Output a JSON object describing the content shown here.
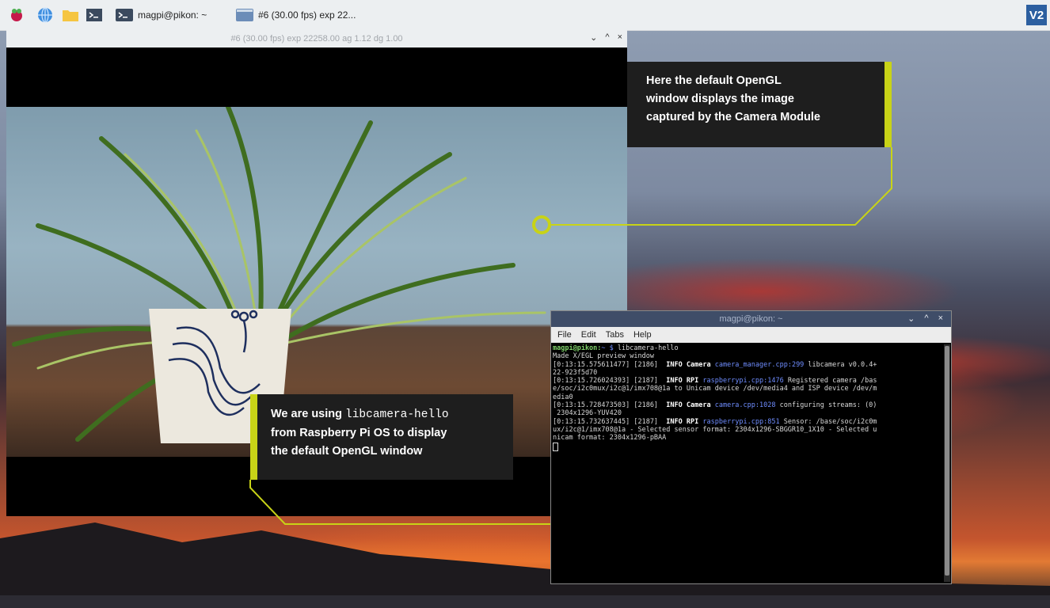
{
  "taskbar": {
    "tasks": [
      {
        "label": "magpi@pikon: ~",
        "icon": "terminal-icon"
      },
      {
        "label": "#6 (30.00 fps) exp 22...",
        "icon": "preview-window-icon"
      }
    ],
    "vnc_label": "V2"
  },
  "preview_window": {
    "title": "#6 (30.00 fps) exp 22258.00 ag 1.12 dg 1.00",
    "controls": [
      "⌄",
      "^",
      "×"
    ]
  },
  "callouts": {
    "top": [
      "Here the default OpenGL",
      "window displays the image",
      "captured by the Camera Module"
    ],
    "bottom_line1_prefix": "We are using ",
    "bottom_line1_code": "libcamera-hello",
    "bottom_line2": "from Raspberry Pi OS to display",
    "bottom_line3": "the default OpenGL window"
  },
  "terminal": {
    "title": "magpi@pikon: ~",
    "controls": [
      "⌄",
      "^",
      "×"
    ],
    "menu": [
      "File",
      "Edit",
      "Tabs",
      "Help"
    ],
    "prompt_user": "magpi@pikon:",
    "prompt_dir": "~ $",
    "command": "libcamera-hello",
    "line_preview": "Made X/EGL preview window",
    "log": [
      {
        "ts": "[0:13:15.575611477] [2186]",
        "level": "INFO",
        "cat": "Camera",
        "src": "camera_manager.cpp:299",
        "msg": " libcamera v0.0.4+",
        "cont": [
          "22-923f5d70"
        ]
      },
      {
        "ts": "[0:13:15.726024393] [2187]",
        "level": "INFO",
        "cat": "RPI",
        "src": "raspberrypi.cpp:1476",
        "msg": " Registered camera /bas",
        "cont": [
          "e/soc/i2c0mux/i2c@1/imx708@1a to Unicam device /dev/media4 and ISP device /dev/m",
          "edia0"
        ]
      },
      {
        "ts": "[0:13:15.728473503] [2186]",
        "level": "INFO",
        "cat": "Camera",
        "src": "camera.cpp:1028",
        "msg": " configuring streams: (0)",
        "cont": [
          " 2304x1296-YUV420"
        ]
      },
      {
        "ts": "[0:13:15.732637445] [2187]",
        "level": "INFO",
        "cat": "RPI",
        "src": "raspberrypi.cpp:851",
        "msg": " Sensor: /base/soc/i2c0m",
        "cont": [
          "ux/i2c@1/imx708@1a - Selected sensor format: 2304x1296-SBGGR10_1X10 - Selected u",
          "nicam format: 2304x1296-pBAA"
        ]
      }
    ]
  },
  "colors": {
    "callout_accent": "#c8d317",
    "callout_bg": "#1e1e1e",
    "taskbar_bg": "#eceff1",
    "terminal_title_bg": "#3f4d68"
  }
}
